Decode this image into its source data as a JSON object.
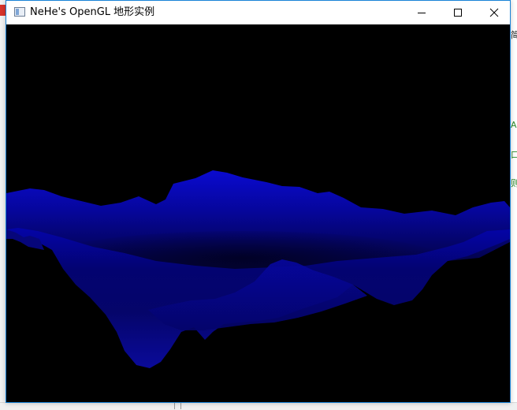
{
  "window": {
    "title": "NeHe's OpenGL 地形实例",
    "controls": [
      "minimize",
      "maximize",
      "close"
    ]
  },
  "background_app": {
    "right_edge_fragments": [
      "简",
      "A",
      "口",
      "则"
    ]
  },
  "render": {
    "background_color": "#000000",
    "terrain_color": "#0000c8"
  }
}
